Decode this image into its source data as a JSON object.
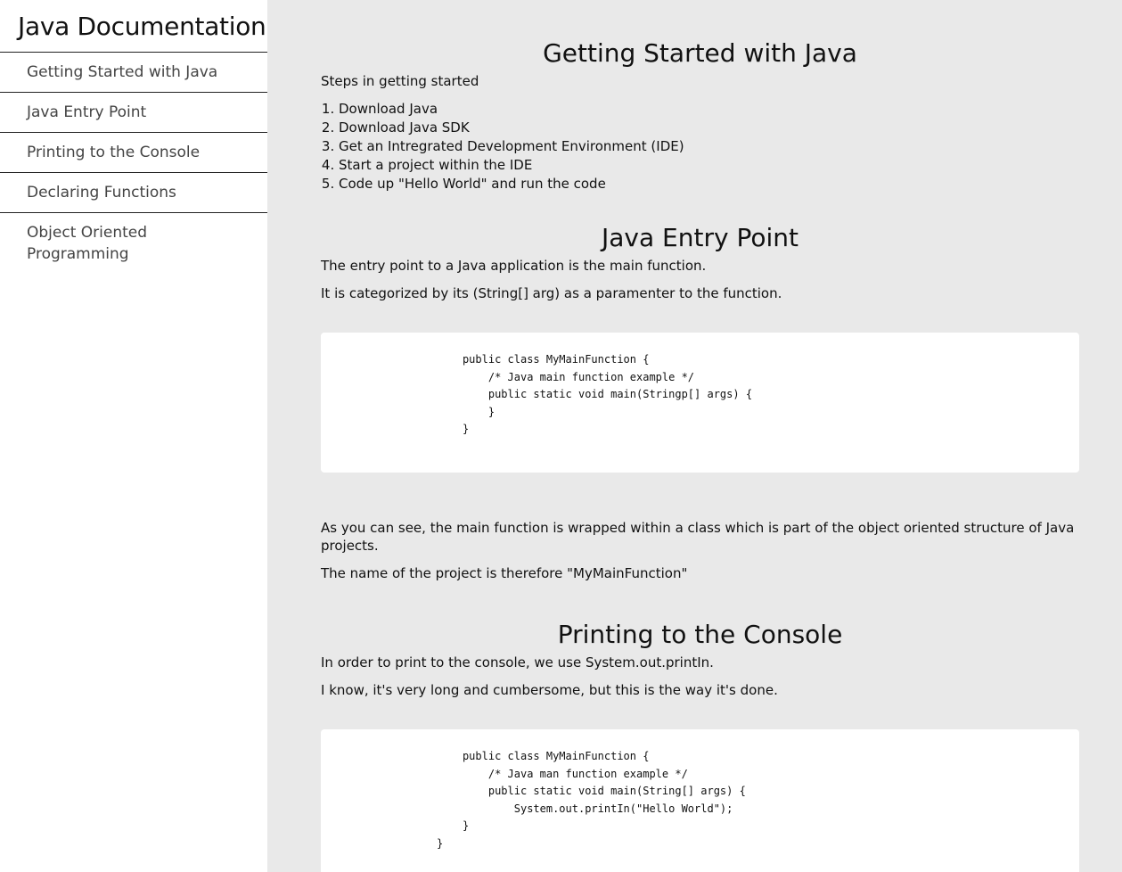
{
  "nav": {
    "title": "Java Documentation",
    "items": [
      {
        "label": "Getting Started with Java"
      },
      {
        "label": "Java Entry Point"
      },
      {
        "label": "Printing to the Console"
      },
      {
        "label": "Declaring Functions"
      },
      {
        "label": "Object Oriented Programming"
      }
    ]
  },
  "sections": {
    "getting_started": {
      "title": "Getting Started with Java",
      "intro": "Steps in getting started",
      "steps": [
        "Download Java",
        "Download Java SDK",
        "Get an Intregrated Development Environment (IDE)",
        "Start a project within the IDE",
        "Code up \"Hello World\" and run the code"
      ]
    },
    "entry_point": {
      "title": "Java Entry Point",
      "p1": "The entry point to a Java application is the main function.",
      "p2": "It is categorized by its (String[] arg) as a paramenter to the function.",
      "code": [
        "                      public class MyMainFunction {",
        "                          /* Java main function example */",
        "                          public static void main(Stringp[] args) {",
        "",
        "                          }",
        "                      }"
      ],
      "p3": "As you can see, the main function is wrapped within a class which is part of the object oriented structure of Java projects.",
      "p4": "The name of the project is therefore \"MyMainFunction\""
    },
    "printing": {
      "title": "Printing to the Console",
      "p1": "In order to print to the console, we use System.out.printIn.",
      "p2": "I know, it's very long and cumbersome, but this is the way it's done.",
      "code": [
        "                      public class MyMainFunction {",
        "                          /* Java man function example */",
        "                          public static void main(String[] args) {",
        "                              System.out.printIn(\"Hello World\");",
        "                      }",
        "                  }"
      ]
    }
  }
}
